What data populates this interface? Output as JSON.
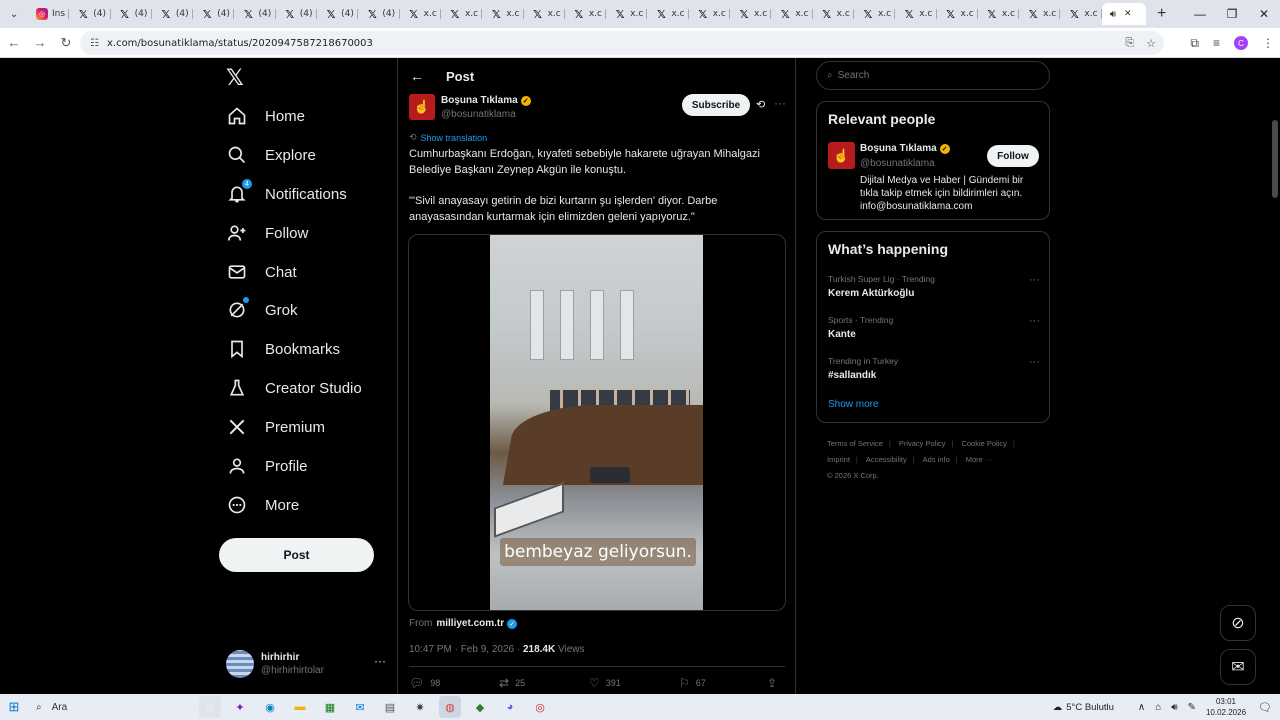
{
  "browser": {
    "tabs": [
      {
        "favicon": "instagram-icon",
        "label": "Ins"
      },
      {
        "favicon": "x-icon",
        "label": "(4)"
      },
      {
        "favicon": "x-icon",
        "label": "(4)"
      },
      {
        "favicon": "x-icon",
        "label": "(4)"
      },
      {
        "favicon": "x-icon",
        "label": "(4)"
      },
      {
        "favicon": "x-icon",
        "label": "(4)"
      },
      {
        "favicon": "x-icon",
        "label": "(4)"
      },
      {
        "favicon": "x-icon",
        "label": "(4)"
      },
      {
        "favicon": "x-icon",
        "label": "(4)"
      },
      {
        "favicon": "x-icon",
        "label": "x.c"
      },
      {
        "favicon": "x-icon",
        "label": "x.c"
      },
      {
        "favicon": "x-icon",
        "label": "x.c"
      },
      {
        "favicon": "x-icon",
        "label": "x.c"
      },
      {
        "favicon": "x-icon",
        "label": "x.c"
      },
      {
        "favicon": "x-icon",
        "label": "x.c"
      },
      {
        "favicon": "x-icon",
        "label": "x.c"
      },
      {
        "favicon": "x-icon",
        "label": "x.c"
      },
      {
        "favicon": "x-icon",
        "label": "x.c"
      },
      {
        "favicon": "x-icon",
        "label": "x.c"
      },
      {
        "favicon": "x-icon",
        "label": "x.c"
      },
      {
        "favicon": "x-icon",
        "label": "x.c"
      },
      {
        "favicon": "x-icon",
        "label": "x.c"
      },
      {
        "favicon": "x-icon",
        "label": "x.c"
      },
      {
        "favicon": "x-icon",
        "label": "x.c"
      },
      {
        "favicon": "x-icon",
        "label": "x.c"
      },
      {
        "favicon": "x-icon",
        "label": "x.c"
      }
    ],
    "url": "x.com/bosunatiklama/status/2020947587218670003"
  },
  "nav": {
    "items": [
      {
        "label": "Home",
        "icon": "home-icon"
      },
      {
        "label": "Explore",
        "icon": "search-icon"
      },
      {
        "label": "Notifications",
        "icon": "bell-icon",
        "badge": "4"
      },
      {
        "label": "Follow",
        "icon": "add-person-icon"
      },
      {
        "label": "Chat",
        "icon": "mail-icon"
      },
      {
        "label": "Grok",
        "icon": "grok-icon"
      },
      {
        "label": "Bookmarks",
        "icon": "bookmark-icon"
      },
      {
        "label": "Creator Studio",
        "icon": "flask-icon"
      },
      {
        "label": "Premium",
        "icon": "x-icon"
      },
      {
        "label": "Profile",
        "icon": "person-icon"
      },
      {
        "label": "More",
        "icon": "more-circle-icon"
      }
    ],
    "post_label": "Post",
    "me": {
      "name": "hirhirhir",
      "handle": "@hirhirhirtolar"
    }
  },
  "post": {
    "header_title": "Post",
    "author_name": "Boşuna Tıklama",
    "author_handle": "@bosunatiklama",
    "subscribe_label": "Subscribe",
    "show_translation": "Show translation",
    "text_1": "Cumhurbaşkanı Erdoğan, kıyafeti sebebiyle hakarete uğrayan Mihalgazi Belediye Başkanı Zeynep Akgün ile konuştu.",
    "text_2": "\"'Sivil anayasayı getirin de bizi kurtarın şu işlerden' diyor. Darbe anayasasından kurtarmak için elimizden geleni yapıyoruz.\"",
    "video_caption": "bembeyaz geliyorsun.",
    "from_label": "From",
    "from_source": "milliyet.com.tr",
    "time": "10:47 PM · Feb 9, 2026 · ",
    "views_count": "218.4K",
    "views_label": " Views",
    "replies": "98",
    "reposts": "25",
    "likes": "391",
    "bookmarks": "67"
  },
  "right": {
    "search_placeholder": "Search",
    "relevant_title": "Relevant people",
    "person_name": "Boşuna Tıklama",
    "person_handle": "@bosunatiklama",
    "follow_label": "Follow",
    "person_bio": "Dijital Medya ve Haber | Gündemi bir tıkla takip etmek için bildirimleri açın. info@bosunatiklama.com",
    "happening_title": "What’s happening",
    "trends": [
      {
        "context": "Turkish Super Lig · Trending",
        "title": "Kerem Aktürkoğlu"
      },
      {
        "context": "Sports · Trending",
        "title": "Kante"
      },
      {
        "context": "Trending in Turkey",
        "title": "#sallandık"
      }
    ],
    "show_more": "Show more",
    "footer": [
      "Terms of Service",
      "Privacy Policy",
      "Cookie Policy",
      "Imprint",
      "Accessibility",
      "Ads info",
      "More ···",
      "© 2026 X Corp."
    ]
  },
  "taskbar": {
    "search": "Ara",
    "weather": "5°C  Bulutlu",
    "time": "03:01",
    "date": "10.02.2026"
  },
  "colors": {
    "accent": "#1d9bf0",
    "verified_gold": "#f4b400",
    "brand_red": "#b71c1c"
  }
}
